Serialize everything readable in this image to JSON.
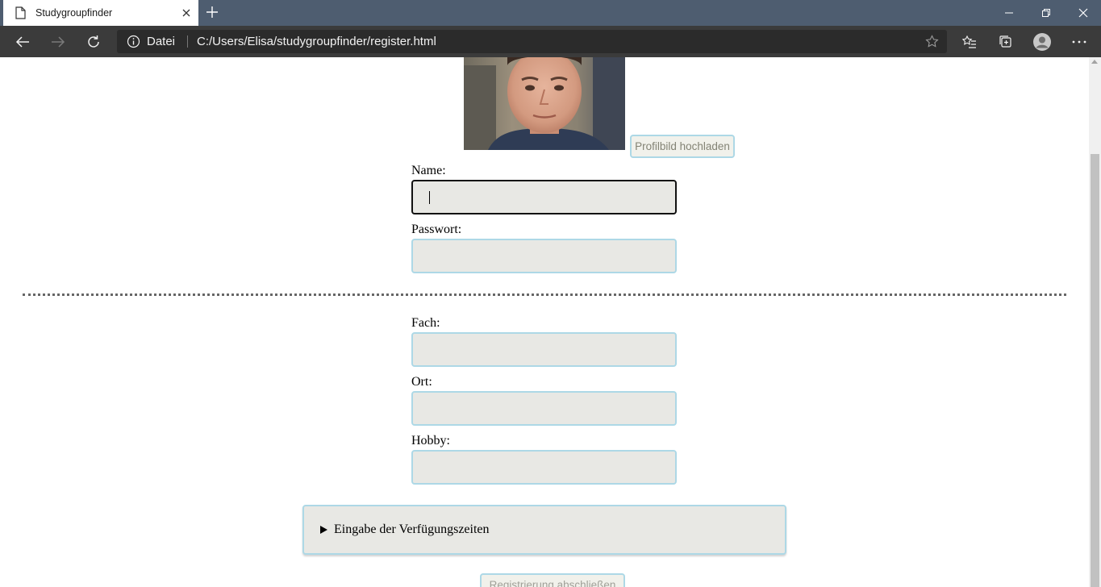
{
  "browser": {
    "tab_title": "Studygroupfinder",
    "address_scheme": "Datei",
    "address_url": "C:/Users/Elisa/studygroupfinder/register.html"
  },
  "form": {
    "upload_button_label": "Profilbild hochladen",
    "name_label": "Name:",
    "password_label": "Passwort:",
    "subject_label": "Fach:",
    "location_label": "Ort:",
    "hobby_label": "Hobby:",
    "availability_summary": "Eingabe der Verfügungszeiten",
    "submit_button_label": "Registrierung abschließen"
  },
  "colors": {
    "field_background": "#e8e8e4",
    "field_border": "#add8e6",
    "tabbar": "#4e5d70",
    "toolbar": "#3b3b3b"
  }
}
